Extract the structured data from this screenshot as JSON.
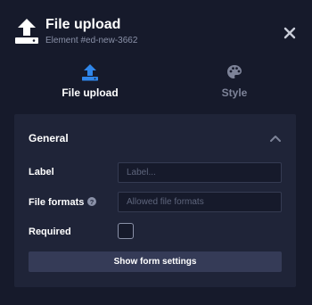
{
  "header": {
    "title": "File upload",
    "subtitle": "Element #ed-new-3662",
    "icon": "upload-icon",
    "close_icon": "close-icon"
  },
  "tabs": [
    {
      "label": "File upload",
      "icon": "upload-icon",
      "active": true
    },
    {
      "label": "Style",
      "icon": "palette-icon",
      "active": false
    }
  ],
  "section": {
    "title": "General",
    "collapse_icon": "chevron-up-icon",
    "fields": {
      "label": {
        "label": "Label",
        "value": "",
        "placeholder": "Label..."
      },
      "file_formats": {
        "label": "File formats",
        "help_icon": "help-icon",
        "value": "",
        "placeholder": "Allowed file formats"
      },
      "required": {
        "label": "Required",
        "checked": false
      }
    },
    "settings_button": "Show form settings"
  },
  "colors": {
    "background": "#161a2b",
    "card": "#1f2438",
    "accent": "#2f86ea",
    "muted_text": "#7d8398",
    "button": "#353b57"
  }
}
